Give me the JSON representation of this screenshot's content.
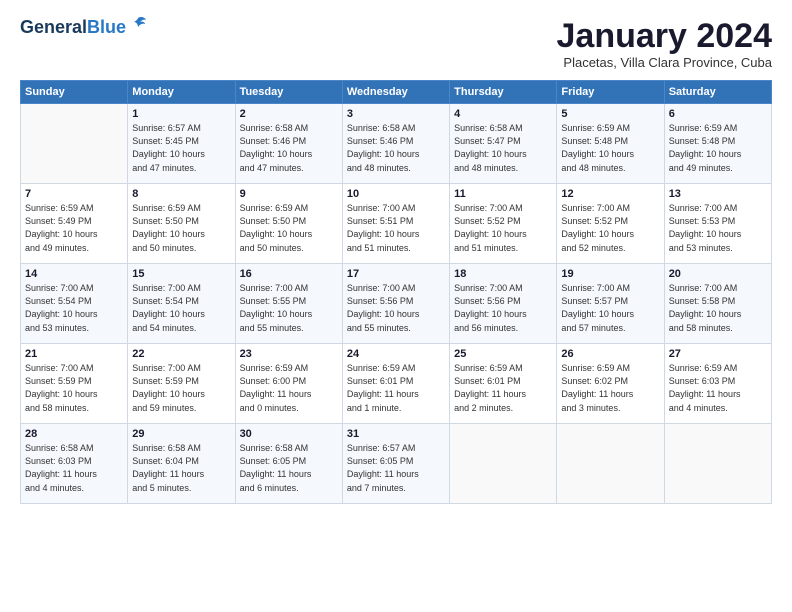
{
  "header": {
    "logo_general": "General",
    "logo_blue": "Blue",
    "month": "January 2024",
    "location": "Placetas, Villa Clara Province, Cuba"
  },
  "days_of_week": [
    "Sunday",
    "Monday",
    "Tuesday",
    "Wednesday",
    "Thursday",
    "Friday",
    "Saturday"
  ],
  "weeks": [
    [
      {
        "day": "",
        "info": ""
      },
      {
        "day": "1",
        "info": "Sunrise: 6:57 AM\nSunset: 5:45 PM\nDaylight: 10 hours\nand 47 minutes."
      },
      {
        "day": "2",
        "info": "Sunrise: 6:58 AM\nSunset: 5:46 PM\nDaylight: 10 hours\nand 47 minutes."
      },
      {
        "day": "3",
        "info": "Sunrise: 6:58 AM\nSunset: 5:46 PM\nDaylight: 10 hours\nand 48 minutes."
      },
      {
        "day": "4",
        "info": "Sunrise: 6:58 AM\nSunset: 5:47 PM\nDaylight: 10 hours\nand 48 minutes."
      },
      {
        "day": "5",
        "info": "Sunrise: 6:59 AM\nSunset: 5:48 PM\nDaylight: 10 hours\nand 48 minutes."
      },
      {
        "day": "6",
        "info": "Sunrise: 6:59 AM\nSunset: 5:48 PM\nDaylight: 10 hours\nand 49 minutes."
      }
    ],
    [
      {
        "day": "7",
        "info": "Sunrise: 6:59 AM\nSunset: 5:49 PM\nDaylight: 10 hours\nand 49 minutes."
      },
      {
        "day": "8",
        "info": "Sunrise: 6:59 AM\nSunset: 5:50 PM\nDaylight: 10 hours\nand 50 minutes."
      },
      {
        "day": "9",
        "info": "Sunrise: 6:59 AM\nSunset: 5:50 PM\nDaylight: 10 hours\nand 50 minutes."
      },
      {
        "day": "10",
        "info": "Sunrise: 7:00 AM\nSunset: 5:51 PM\nDaylight: 10 hours\nand 51 minutes."
      },
      {
        "day": "11",
        "info": "Sunrise: 7:00 AM\nSunset: 5:52 PM\nDaylight: 10 hours\nand 51 minutes."
      },
      {
        "day": "12",
        "info": "Sunrise: 7:00 AM\nSunset: 5:52 PM\nDaylight: 10 hours\nand 52 minutes."
      },
      {
        "day": "13",
        "info": "Sunrise: 7:00 AM\nSunset: 5:53 PM\nDaylight: 10 hours\nand 53 minutes."
      }
    ],
    [
      {
        "day": "14",
        "info": "Sunrise: 7:00 AM\nSunset: 5:54 PM\nDaylight: 10 hours\nand 53 minutes."
      },
      {
        "day": "15",
        "info": "Sunrise: 7:00 AM\nSunset: 5:54 PM\nDaylight: 10 hours\nand 54 minutes."
      },
      {
        "day": "16",
        "info": "Sunrise: 7:00 AM\nSunset: 5:55 PM\nDaylight: 10 hours\nand 55 minutes."
      },
      {
        "day": "17",
        "info": "Sunrise: 7:00 AM\nSunset: 5:56 PM\nDaylight: 10 hours\nand 55 minutes."
      },
      {
        "day": "18",
        "info": "Sunrise: 7:00 AM\nSunset: 5:56 PM\nDaylight: 10 hours\nand 56 minutes."
      },
      {
        "day": "19",
        "info": "Sunrise: 7:00 AM\nSunset: 5:57 PM\nDaylight: 10 hours\nand 57 minutes."
      },
      {
        "day": "20",
        "info": "Sunrise: 7:00 AM\nSunset: 5:58 PM\nDaylight: 10 hours\nand 58 minutes."
      }
    ],
    [
      {
        "day": "21",
        "info": "Sunrise: 7:00 AM\nSunset: 5:59 PM\nDaylight: 10 hours\nand 58 minutes."
      },
      {
        "day": "22",
        "info": "Sunrise: 7:00 AM\nSunset: 5:59 PM\nDaylight: 10 hours\nand 59 minutes."
      },
      {
        "day": "23",
        "info": "Sunrise: 6:59 AM\nSunset: 6:00 PM\nDaylight: 11 hours\nand 0 minutes."
      },
      {
        "day": "24",
        "info": "Sunrise: 6:59 AM\nSunset: 6:01 PM\nDaylight: 11 hours\nand 1 minute."
      },
      {
        "day": "25",
        "info": "Sunrise: 6:59 AM\nSunset: 6:01 PM\nDaylight: 11 hours\nand 2 minutes."
      },
      {
        "day": "26",
        "info": "Sunrise: 6:59 AM\nSunset: 6:02 PM\nDaylight: 11 hours\nand 3 minutes."
      },
      {
        "day": "27",
        "info": "Sunrise: 6:59 AM\nSunset: 6:03 PM\nDaylight: 11 hours\nand 4 minutes."
      }
    ],
    [
      {
        "day": "28",
        "info": "Sunrise: 6:58 AM\nSunset: 6:03 PM\nDaylight: 11 hours\nand 4 minutes."
      },
      {
        "day": "29",
        "info": "Sunrise: 6:58 AM\nSunset: 6:04 PM\nDaylight: 11 hours\nand 5 minutes."
      },
      {
        "day": "30",
        "info": "Sunrise: 6:58 AM\nSunset: 6:05 PM\nDaylight: 11 hours\nand 6 minutes."
      },
      {
        "day": "31",
        "info": "Sunrise: 6:57 AM\nSunset: 6:05 PM\nDaylight: 11 hours\nand 7 minutes."
      },
      {
        "day": "",
        "info": ""
      },
      {
        "day": "",
        "info": ""
      },
      {
        "day": "",
        "info": ""
      }
    ]
  ]
}
